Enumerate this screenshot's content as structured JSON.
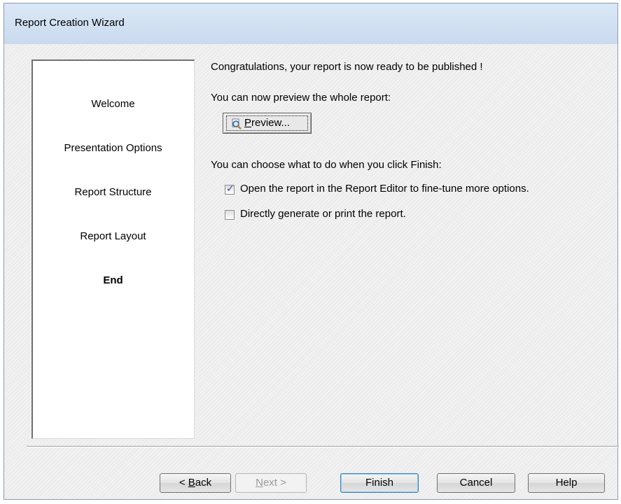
{
  "window": {
    "title": "Report Creation Wizard"
  },
  "steps": [
    {
      "label": "Welcome",
      "current": false
    },
    {
      "label": "Presentation Options",
      "current": false
    },
    {
      "label": "Report Structure",
      "current": false
    },
    {
      "label": "Report Layout",
      "current": false
    },
    {
      "label": "End",
      "current": true
    }
  ],
  "main": {
    "congrats": "Congratulations, your report is now ready to be published !",
    "preview_prompt": "You can now preview the whole report:",
    "preview_button": {
      "label_mnemonic": "P",
      "label_rest": "review...",
      "icon": "magnifier-document-icon"
    },
    "finish_prompt": "You can choose what to do when you click Finish:",
    "options": [
      {
        "label": "Open the report in the Report Editor to fine-tune more options.",
        "checked": true
      },
      {
        "label": "Directly generate or print the report.",
        "checked": false
      }
    ]
  },
  "footer": {
    "back": {
      "prefix": "< ",
      "mnemonic": "B",
      "rest": "ack"
    },
    "next": {
      "mnemonic": "N",
      "rest": "ext >",
      "enabled": false
    },
    "finish": "Finish",
    "cancel": "Cancel",
    "help": "Help"
  },
  "colors": {
    "titlebar": "#c9daee",
    "checkmark": "#2a4b9b",
    "default_button_border": "#3c7fb1"
  }
}
